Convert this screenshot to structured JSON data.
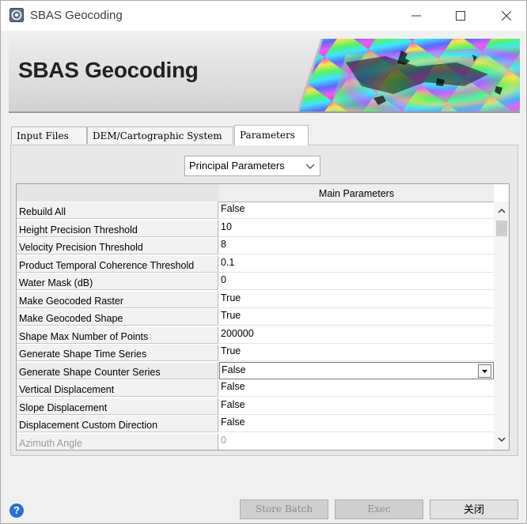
{
  "window": {
    "title": "SBAS Geocoding",
    "icon": "app-icon"
  },
  "banner": {
    "title": "SBAS Geocoding"
  },
  "tabs": [
    {
      "label": "Input Files",
      "active": false
    },
    {
      "label": "DEM/Cartographic System",
      "active": false
    },
    {
      "label": "Parameters",
      "active": true
    }
  ],
  "parameter_group": {
    "selected": "Principal Parameters"
  },
  "table": {
    "column_header": "Main Parameters",
    "rows": [
      {
        "name": "Rebuild All",
        "value": "False"
      },
      {
        "name": "Height Precision Threshold",
        "value": "10"
      },
      {
        "name": "Velocity Precision Threshold",
        "value": "8"
      },
      {
        "name": "Product Temporal Coherence Threshold",
        "value": "0.1"
      },
      {
        "name": "Water Mask (dB)",
        "value": "0"
      },
      {
        "name": "Make Geocoded Raster",
        "value": "True"
      },
      {
        "name": "Make Geocoded Shape",
        "value": "True"
      },
      {
        "name": "Shape Max Number of Points",
        "value": "200000"
      },
      {
        "name": "Generate Shape Time Series",
        "value": "True"
      },
      {
        "name": "Generate Shape Counter Series",
        "value": "False"
      },
      {
        "name": "Vertical Displacement",
        "value": "False"
      },
      {
        "name": "Slope Displacement",
        "value": "False"
      },
      {
        "name": "Displacement Custom Direction",
        "value": "False"
      },
      {
        "name": "Azimuth Angle",
        "value": "0"
      }
    ]
  },
  "buttons": {
    "store_batch": "Store Batch",
    "exec": "Exec",
    "close": "关闭"
  }
}
